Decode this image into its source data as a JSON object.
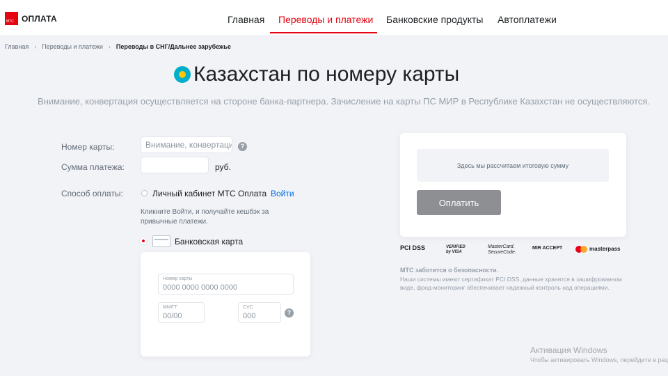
{
  "header": {
    "logo_mark": "М\nТ\nС",
    "logo_text": "ОПЛАТА",
    "nav": [
      {
        "label": "Главная",
        "active": false
      },
      {
        "label": "Переводы и платежи",
        "active": true
      },
      {
        "label": "Банковские продукты",
        "active": false
      },
      {
        "label": "Автоплатежи",
        "active": false
      }
    ]
  },
  "breadcrumb": {
    "items": [
      "Главная",
      "Переводы и платежи"
    ],
    "current": "Переводы в СНГ/Дальнее зарубежье"
  },
  "page": {
    "title": "Казахстан по номеру карты",
    "notice": "Внимание, конвертация осуществляется на стороне банка-партнера. Зачисление на карты ПС МИР в Республике Казахстан не осуществляются."
  },
  "form": {
    "card_number_label": "Номер карты:",
    "card_number_value": "Внимание, конвертация",
    "help_glyph": "?",
    "amount_label": "Сумма платежа:",
    "amount_value": "",
    "amount_unit": "руб.",
    "payment_method_label": "Способ оплаты:",
    "option_account": "Личный кабинет МТС Оплата",
    "login_link": "Войти",
    "hint": "Кликните Войти, и получайте кешбэк за привычные платежи.",
    "option_card": "Банковская карта",
    "card": {
      "number_label": "Номер карты",
      "number_placeholder": "0000 0000 0000 0000",
      "expiry_label": "ММ/ГГ",
      "expiry_placeholder": "00/00",
      "cvc_label": "CVC",
      "cvc_placeholder": "000"
    }
  },
  "summary": {
    "text": "Здесь мы рассчитаем итоговую сумму",
    "pay_button": "Оплатить"
  },
  "security": {
    "logos": [
      "PCI DSS",
      "VERIFIED by VISA",
      "MasterCard. SecureCode.",
      "MIR ACCEPT",
      "masterpass"
    ],
    "title": "МТС заботится о безопасности.",
    "text": "Наши системы имеют сертификат PCI DSS, данные хранятся в зашифрованном виде, фрод-мониторинг обеспечивает надежный контроль над операциями."
  },
  "watermark": {
    "title": "Активация Windows",
    "text": "Чтобы активировать Windows, перейдите в раздел"
  },
  "colors": {
    "accent": "#e30611",
    "link": "#0070e5",
    "button_disabled": "#8d8f93",
    "background": "#f2f3f7"
  }
}
